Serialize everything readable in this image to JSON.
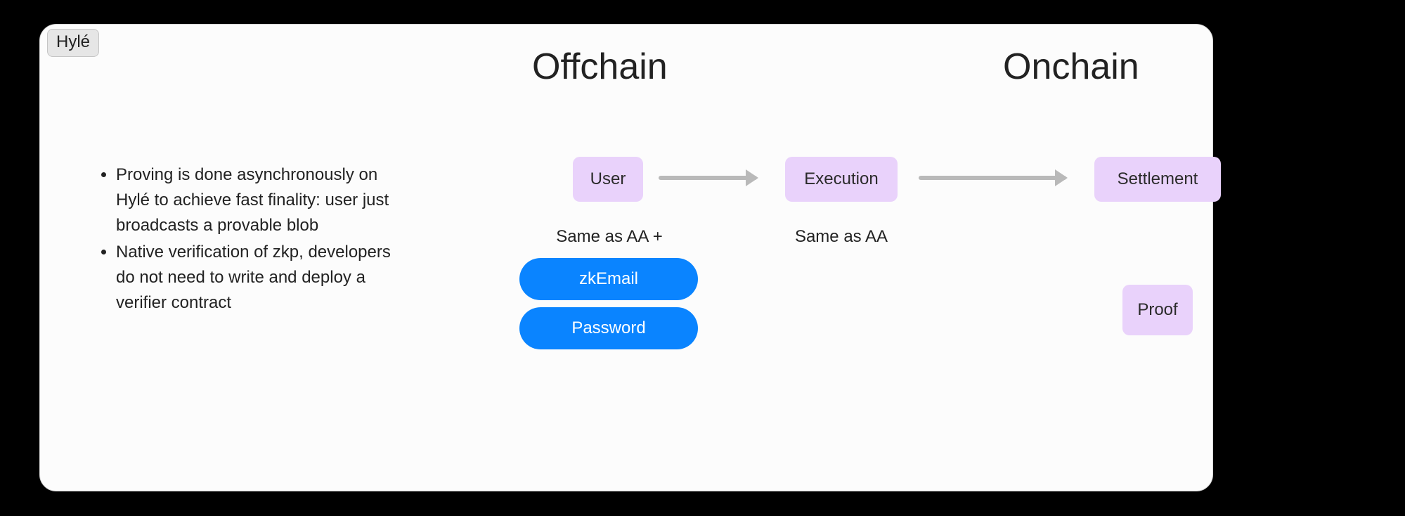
{
  "tab_label": "Hylé",
  "headings": {
    "offchain": "Offchain",
    "onchain": "Onchain"
  },
  "bullets": [
    "Proving is done asynchronously on Hylé to achieve fast finality: user just broadcasts a provable blob",
    "Native verification of zkp, developers do not need to write and deploy a verifier contract"
  ],
  "flow": {
    "user_box": "User",
    "execution_box": "Execution",
    "settlement_box": "Settlement",
    "proof_box": "Proof",
    "user_caption": "Same as AA +",
    "execution_caption": "Same as AA",
    "pill_zkemail": "zkEmail",
    "pill_password": "Password"
  }
}
